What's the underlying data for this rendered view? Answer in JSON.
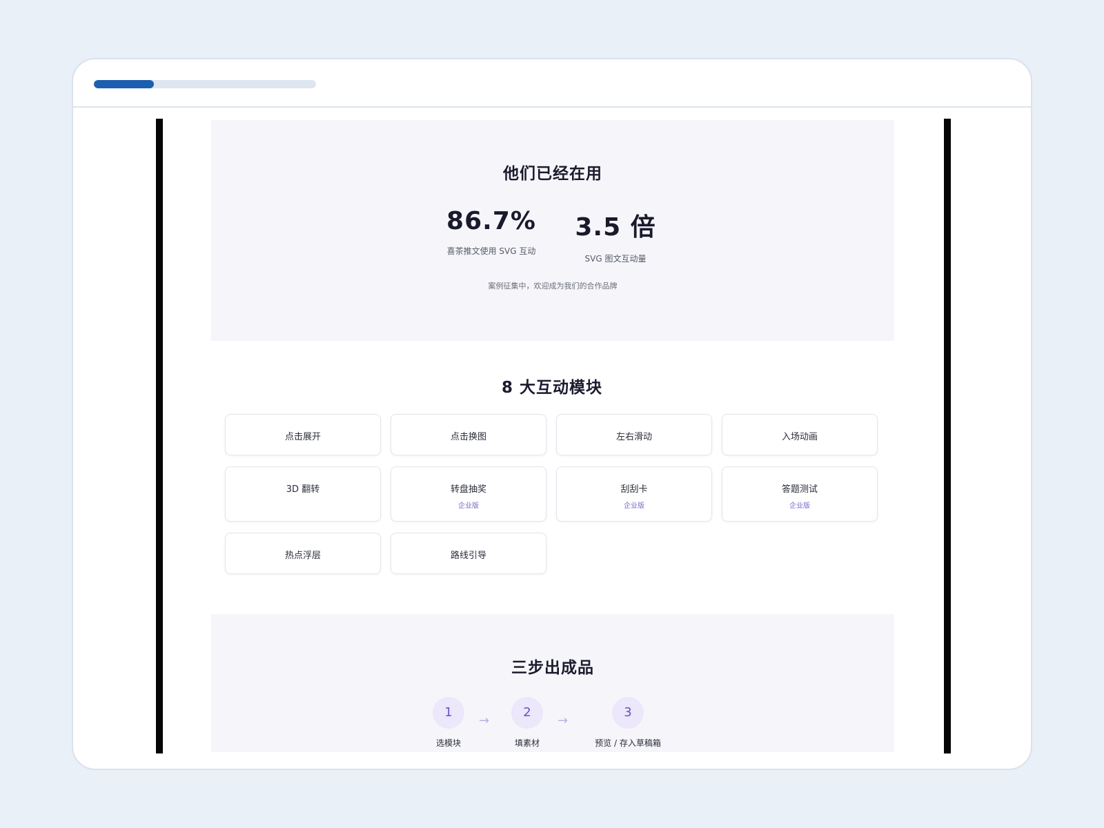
{
  "progress": {
    "value": 0.27
  },
  "stats_section": {
    "title": "他们已经在用",
    "stats": [
      {
        "value": "86.7%",
        "label": "喜茶推文使用 SVG 互动"
      },
      {
        "value": "3.5 倍",
        "label": "SVG 图文互动量"
      }
    ],
    "note": "案例征集中，欢迎成为我们的合作品牌"
  },
  "modules_section": {
    "title": "8 大互动模块",
    "modules": [
      {
        "label": "点击展开",
        "tag": ""
      },
      {
        "label": "点击换图",
        "tag": ""
      },
      {
        "label": "左右滑动",
        "tag": ""
      },
      {
        "label": "入场动画",
        "tag": ""
      },
      {
        "label": "3D 翻转",
        "tag": ""
      },
      {
        "label": "转盘抽奖",
        "tag": "企业版"
      },
      {
        "label": "刮刮卡",
        "tag": "企业版"
      },
      {
        "label": "答题测试",
        "tag": "企业版"
      },
      {
        "label": "热点浮层",
        "tag": ""
      },
      {
        "label": "路线引导",
        "tag": ""
      }
    ]
  },
  "steps_section": {
    "title": "三步出成品",
    "steps": [
      {
        "number": "1",
        "label": "选模块"
      },
      {
        "number": "2",
        "label": "填素材"
      },
      {
        "number": "3",
        "label": "预览 / 存入草稿箱"
      }
    ],
    "arrow": "→"
  }
}
